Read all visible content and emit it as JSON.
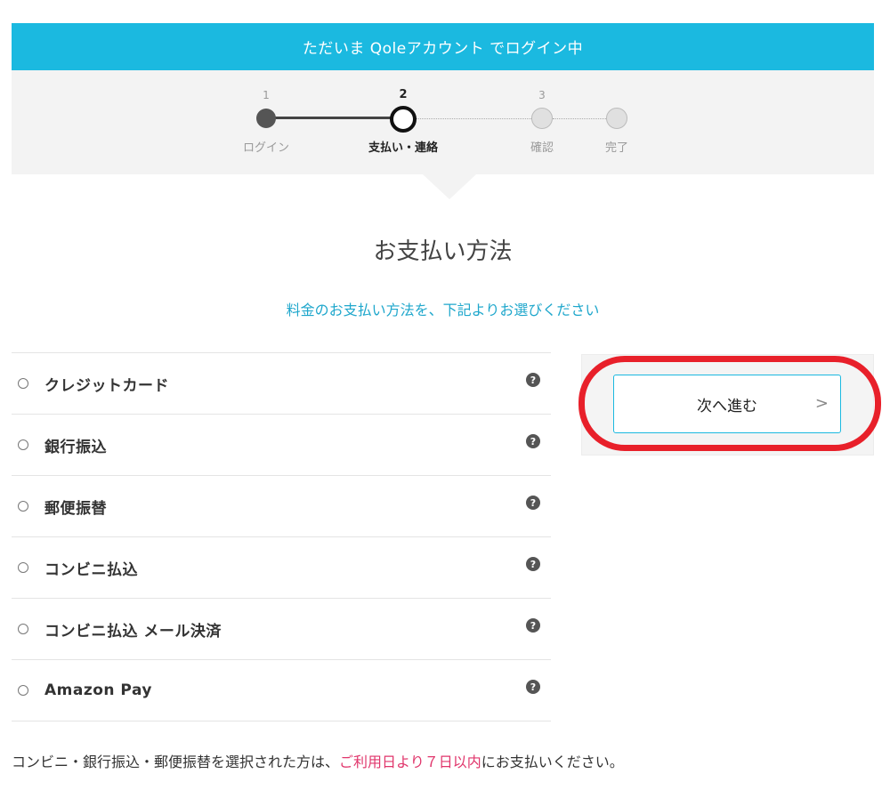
{
  "banner": {
    "text": "ただいま Qoleアカウント でログイン中"
  },
  "steps": [
    {
      "num": "1",
      "label": "ログイン",
      "state": "done"
    },
    {
      "num": "2",
      "label": "支払い・連絡",
      "state": "active"
    },
    {
      "num": "3",
      "label": "確認",
      "state": "upcoming"
    },
    {
      "num": "",
      "label": "完了",
      "state": "upcoming"
    }
  ],
  "page": {
    "title": "お支払い方法",
    "subtitle": "料金のお支払い方法を、下記よりお選びください"
  },
  "payment_methods": [
    {
      "label": "クレジットカード",
      "help_icon": "question-circle-icon"
    },
    {
      "label": "銀行振込",
      "help_icon": "question-circle-icon"
    },
    {
      "label": "郵便振替",
      "help_icon": "question-circle-icon"
    },
    {
      "label": "コンビニ払込",
      "help_icon": "question-circle-icon"
    },
    {
      "label": "コンビニ払込 メール決済",
      "help_icon": "question-circle-icon"
    },
    {
      "label": "Amazon Pay",
      "help_icon": "question-circle-icon"
    }
  ],
  "help_glyph": "?",
  "next": {
    "label": "次へ進む",
    "arrow": ">"
  },
  "note": {
    "before": "コンビニ・銀行振込・郵便振替を選択された方は、",
    "emphasis": "ご利用日より７日以内",
    "after": "にお支払いください。"
  },
  "colors": {
    "accent": "#1bb9e0",
    "subtitle": "#1fa7cc",
    "highlight": "#e8202a",
    "emphasis": "#e0356b"
  }
}
